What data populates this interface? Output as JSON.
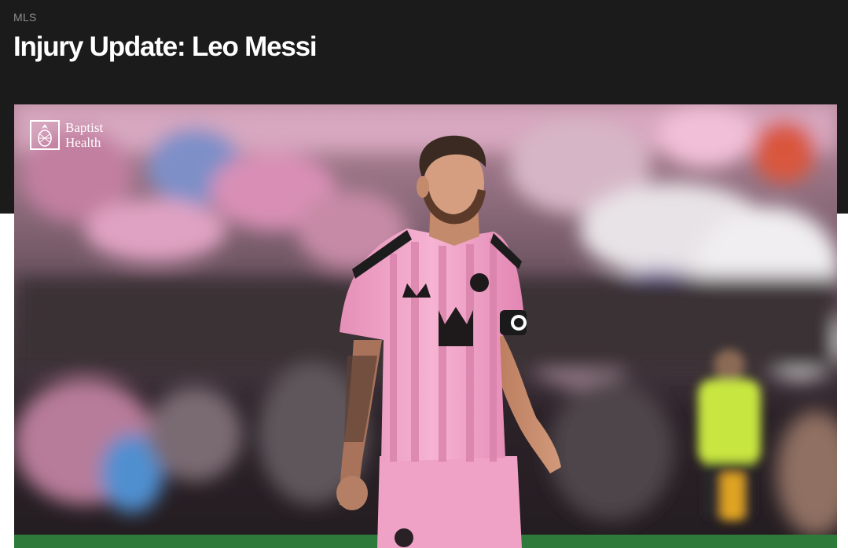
{
  "article": {
    "category": "MLS",
    "headline": "Injury Update: Leo Messi"
  },
  "hero_image": {
    "sponsor_name": "Baptist Health",
    "sponsor_icon": "pineapple-icon",
    "jersey_sponsor_icon": "crown-icon"
  },
  "colors": {
    "header_background": "#1b1b1c",
    "headline_text": "#ffffff",
    "category_text": "#8d8d8f",
    "jersey_pink": "#f1a3c8",
    "pitch_green": "#2e7a3a",
    "referee_yellow": "#c8e640"
  }
}
